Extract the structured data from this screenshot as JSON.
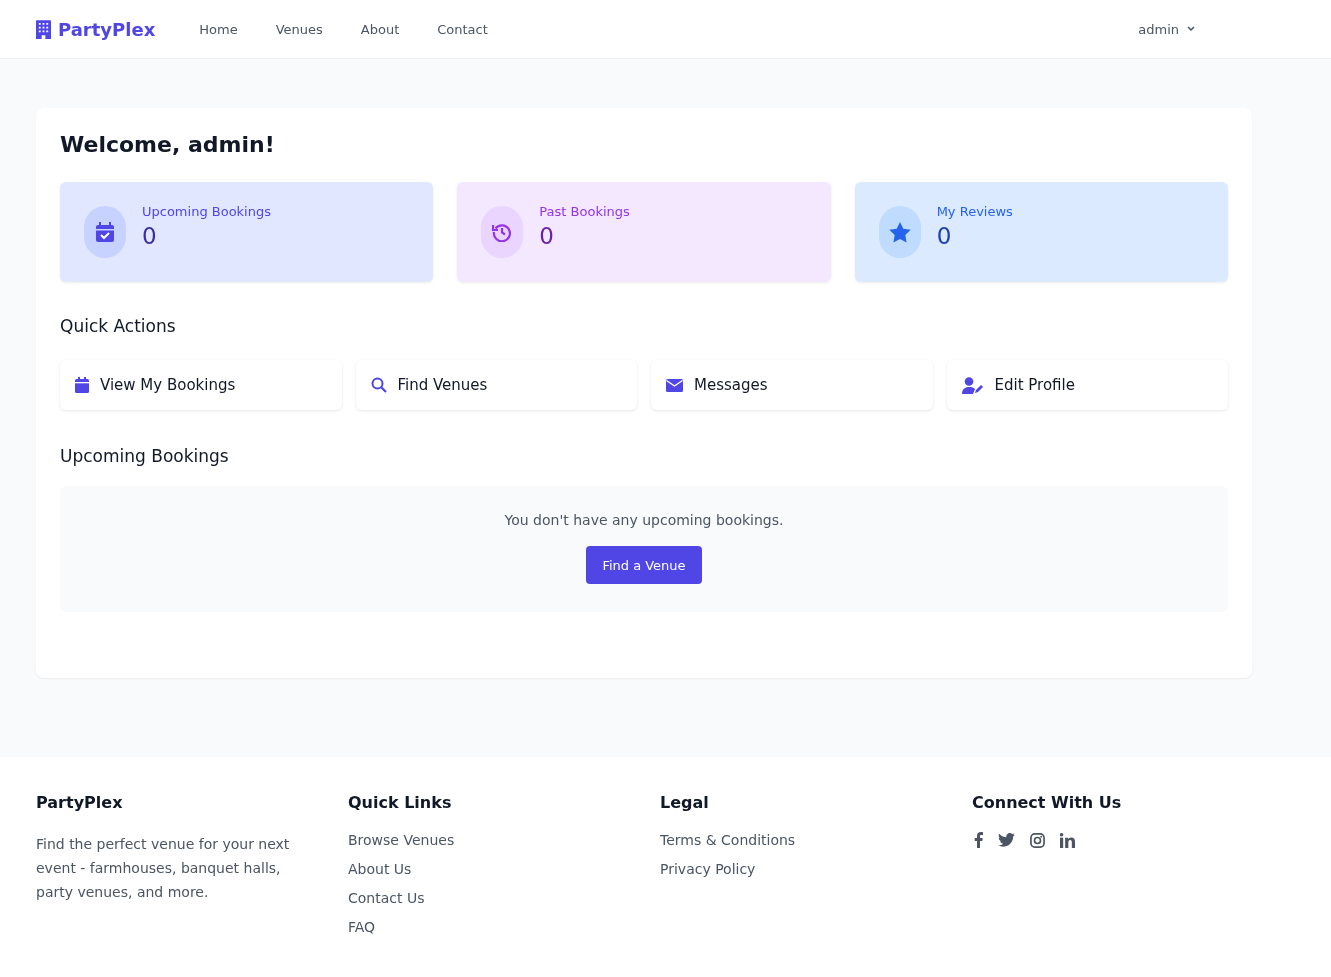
{
  "brand": "PartyPlex",
  "nav": [
    {
      "label": "Home"
    },
    {
      "label": "Venues"
    },
    {
      "label": "About"
    },
    {
      "label": "Contact"
    }
  ],
  "user_menu": {
    "label": "admin"
  },
  "welcome": "Welcome, admin!",
  "stats": [
    {
      "kind": "upcoming",
      "label": "Upcoming Bookings",
      "value": "0"
    },
    {
      "kind": "past",
      "label": "Past Bookings",
      "value": "0"
    },
    {
      "kind": "reviews",
      "label": "My Reviews",
      "value": "0"
    }
  ],
  "quick_actions": {
    "title": "Quick Actions",
    "items": [
      {
        "kind": "calendar",
        "label": "View My Bookings"
      },
      {
        "kind": "search",
        "label": "Find Venues"
      },
      {
        "kind": "mail",
        "label": "Messages"
      },
      {
        "kind": "profile",
        "label": "Edit Profile"
      }
    ]
  },
  "upcoming": {
    "title": "Upcoming Bookings",
    "empty_message": "You don't have any upcoming bookings.",
    "button": "Find a Venue"
  },
  "footer": {
    "about": {
      "title": "PartyPlex",
      "text": "Find the perfect venue for your next event - farmhouses, banquet halls, party venues, and more."
    },
    "quick_links": {
      "title": "Quick Links",
      "links": [
        "Browse Venues",
        "About Us",
        "Contact Us",
        "FAQ"
      ]
    },
    "legal": {
      "title": "Legal",
      "links": [
        "Terms & Conditions",
        "Privacy Policy"
      ]
    },
    "connect": {
      "title": "Connect With Us"
    }
  }
}
